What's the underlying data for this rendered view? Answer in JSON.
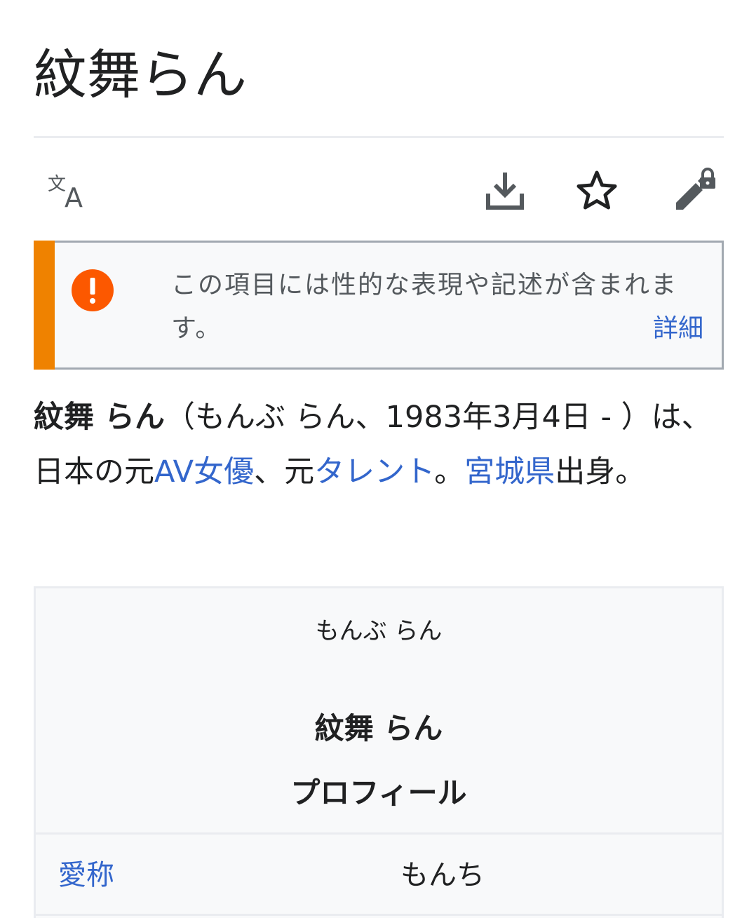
{
  "page": {
    "title": "紋舞らん"
  },
  "toolbar": {
    "language_label": "文A",
    "icons": [
      "language-icon",
      "download-icon",
      "star-icon",
      "edit-lock-icon"
    ]
  },
  "notice": {
    "text": "この項目には性的な表現や記述が含まれます。",
    "more_link": "詳細",
    "accent_color": "#ef8200"
  },
  "lead": {
    "name_bold": "紋舞 らん",
    "part1": "（もんぶ らん、1983年3月4日 - ）は、日本の元",
    "link_av": "AV女優",
    "part2": "、元",
    "link_talent": "タレント",
    "part3": "。",
    "link_pref": "宮城県",
    "part4": "出身。",
    "link_color": "#3366cc"
  },
  "infobox": {
    "reading": "もんぶ らん",
    "name": "紋舞 らん",
    "section": "プロフィール",
    "rows": [
      {
        "label": "愛称",
        "value": "もんち"
      }
    ]
  }
}
